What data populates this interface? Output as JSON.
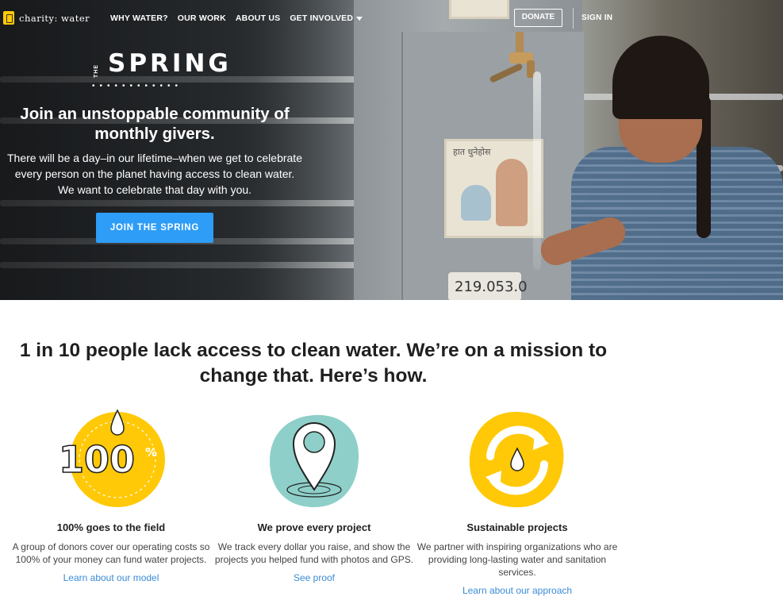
{
  "nav": {
    "logo_text": "charity: water",
    "links": [
      "WHY WATER?",
      "OUR WORK",
      "ABOUT US",
      "GET INVOLVED"
    ],
    "donate_label": "DONATE",
    "signin_label": "SIGN IN"
  },
  "hero": {
    "brand_small": "THE",
    "brand": "SPRING",
    "heading": "Join an unstoppable community of monthly givers.",
    "subtext": "There will be a day–in our lifetime–when we get to celebrate every person on the planet having access to clean water. We want to celebrate that day with you.",
    "cta_label": "JOIN THE SPRING",
    "tile_text": "हात धुनेहोस",
    "plate_text": "219.053.0"
  },
  "mission": {
    "heading": "1 in 10 people lack access to clean water. We’re on a mission to change that. Here’s how."
  },
  "cards": [
    {
      "icon": "hundred-percent-icon",
      "title": "100% goes to the field",
      "desc": "A group of donors cover our operating costs so 100% of your money can fund water projects.",
      "link": "Learn about our model"
    },
    {
      "icon": "map-pin-icon",
      "title": "We prove every project",
      "desc": "We track every dollar you raise, and show the projects you helped fund with photos and GPS.",
      "link": "See proof"
    },
    {
      "icon": "recycle-drop-icon",
      "title": "Sustainable projects",
      "desc": "We partner with inspiring organizations who are providing long-lasting water and sanitation services.",
      "link": "Learn about our approach"
    }
  ],
  "colors": {
    "accent_yellow": "#FFC907",
    "accent_teal": "#8ED0C9",
    "cta_blue": "#2E9DF7",
    "link_blue": "#3B8BD6"
  }
}
